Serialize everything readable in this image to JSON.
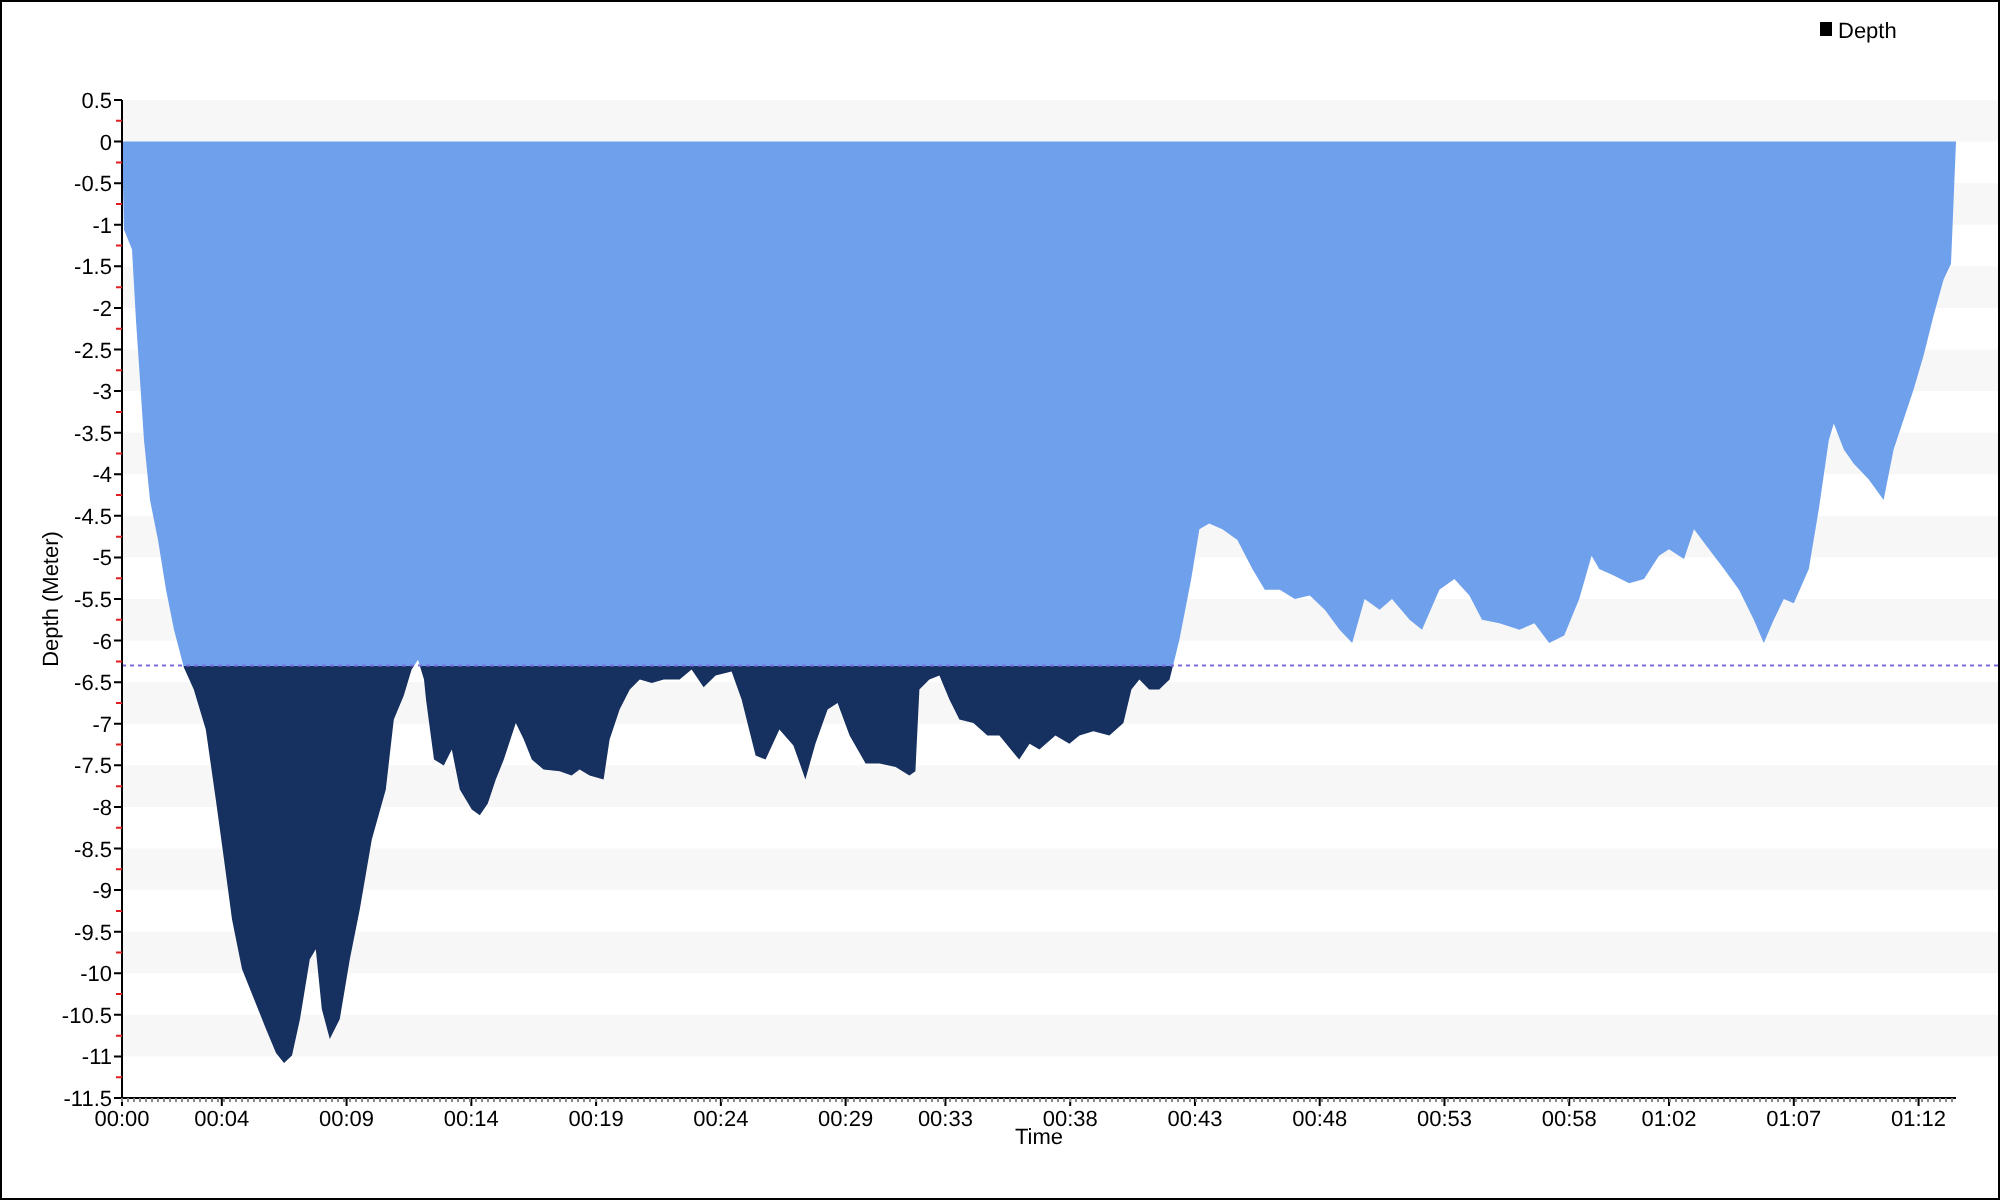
{
  "chart_data": {
    "type": "area",
    "xlabel": "Time",
    "ylabel": "Depth (Meter)",
    "x": [
      0,
      0.08,
      0.4,
      0.56,
      0.72,
      0.88,
      1.12,
      1.44,
      1.76,
      2.08,
      2.48,
      2.88,
      3.36,
      3.76,
      4.09,
      4.41,
      4.81,
      5.29,
      5.77,
      6.17,
      6.49,
      6.81,
      7.13,
      7.53,
      7.77,
      8.01,
      8.33,
      8.73,
      9.13,
      9.53,
      10.01,
      10.57,
      10.89,
      11.29,
      11.61,
      11.86,
      12.1,
      12.18,
      12.5,
      12.9,
      13.22,
      13.54,
      14.02,
      14.34,
      14.66,
      14.98,
      15.3,
      15.78,
      16.1,
      16.42,
      16.9,
      17.54,
      18.02,
      18.34,
      18.74,
      19.3,
      19.54,
      19.94,
      20.35,
      20.75,
      21.23,
      21.71,
      22.35,
      22.83,
      23.31,
      23.79,
      24.43,
      24.83,
      25.39,
      25.79,
      26.35,
      26.91,
      27.39,
      27.79,
      28.28,
      28.68,
      29.16,
      29.8,
      30.36,
      31.0,
      31.56,
      31.8,
      31.96,
      32.36,
      32.76,
      33.16,
      33.56,
      34.12,
      34.68,
      35.16,
      35.96,
      36.37,
      36.77,
      37.41,
      37.97,
      38.37,
      38.93,
      39.57,
      40.13,
      40.45,
      40.77,
      41.17,
      41.57,
      41.98,
      42.38,
      42.85,
      43.18,
      43.57,
      44.1,
      44.7,
      45.3,
      45.8,
      46.4,
      47.0,
      47.6,
      48.2,
      48.8,
      49.3,
      49.8,
      50.4,
      50.9,
      51.6,
      52.1,
      52.8,
      53.4,
      54.0,
      54.5,
      55.2,
      56.0,
      56.6,
      57.2,
      57.8,
      58.4,
      58.9,
      59.2,
      59.8,
      60.4,
      61.0,
      61.6,
      62.0,
      62.6,
      63.0,
      63.6,
      64.2,
      64.8,
      65.4,
      65.8,
      66.2,
      66.6,
      67.0,
      67.6,
      68.0,
      68.4,
      68.6,
      69.0,
      69.4,
      70.0,
      70.6,
      71.0,
      71.4,
      71.8,
      72.2,
      72.6,
      73.0,
      73.3,
      73.5
    ],
    "series": [
      {
        "name": "Depth",
        "color": "#6fa0ec",
        "values": [
          0,
          -1.06,
          -1.3,
          -2.15,
          -2.87,
          -3.59,
          -4.31,
          -4.79,
          -5.39,
          -5.87,
          -6.32,
          -6.59,
          -7.07,
          -7.91,
          -8.63,
          -9.35,
          -9.95,
          -10.31,
          -10.67,
          -10.96,
          -11.08,
          -10.99,
          -10.55,
          -9.83,
          -9.71,
          -10.43,
          -10.79,
          -10.55,
          -9.83,
          -9.23,
          -8.39,
          -7.79,
          -6.95,
          -6.66,
          -6.35,
          -6.23,
          -6.47,
          -6.71,
          -7.43,
          -7.5,
          -7.31,
          -7.79,
          -8.03,
          -8.1,
          -7.96,
          -7.67,
          -7.43,
          -6.99,
          -7.19,
          -7.43,
          -7.55,
          -7.57,
          -7.62,
          -7.55,
          -7.62,
          -7.67,
          -7.19,
          -6.83,
          -6.59,
          -6.47,
          -6.51,
          -6.47,
          -6.47,
          -6.35,
          -6.56,
          -6.42,
          -6.37,
          -6.71,
          -7.38,
          -7.43,
          -7.07,
          -7.26,
          -7.67,
          -7.24,
          -6.83,
          -6.75,
          -7.14,
          -7.48,
          -7.48,
          -7.52,
          -7.62,
          -7.57,
          -6.59,
          -6.47,
          -6.42,
          -6.71,
          -6.95,
          -6.99,
          -7.14,
          -7.14,
          -7.43,
          -7.24,
          -7.31,
          -7.14,
          -7.24,
          -7.14,
          -7.09,
          -7.14,
          -6.99,
          -6.59,
          -6.47,
          -6.59,
          -6.59,
          -6.47,
          -5.99,
          -5.26,
          -4.66,
          -4.59,
          -4.66,
          -4.79,
          -5.14,
          -5.39,
          -5.39,
          -5.5,
          -5.46,
          -5.63,
          -5.87,
          -6.03,
          -5.5,
          -5.63,
          -5.5,
          -5.75,
          -5.87,
          -5.39,
          -5.26,
          -5.46,
          -5.75,
          -5.79,
          -5.87,
          -5.79,
          -6.03,
          -5.94,
          -5.5,
          -4.98,
          -5.14,
          -5.22,
          -5.31,
          -5.26,
          -4.98,
          -4.9,
          -5.02,
          -4.66,
          -4.9,
          -5.14,
          -5.39,
          -5.75,
          -6.03,
          -5.75,
          -5.5,
          -5.55,
          -5.14,
          -4.42,
          -3.59,
          -3.39,
          -3.7,
          -3.87,
          -4.06,
          -4.31,
          -3.7,
          -3.34,
          -2.98,
          -2.57,
          -2.09,
          -1.66,
          -1.47,
          0
        ]
      }
    ],
    "xlim": [
      0,
      73.5
    ],
    "ylim": [
      -11.5,
      0.5
    ],
    "xticks": [
      {
        "value": 0,
        "label": "00:00"
      },
      {
        "value": 4,
        "label": "00:04"
      },
      {
        "value": 9,
        "label": "00:09"
      },
      {
        "value": 14,
        "label": "00:14"
      },
      {
        "value": 19,
        "label": "00:19"
      },
      {
        "value": 24,
        "label": "00:24"
      },
      {
        "value": 29,
        "label": "00:29"
      },
      {
        "value": 33,
        "label": "00:33"
      },
      {
        "value": 38,
        "label": "00:38"
      },
      {
        "value": 43,
        "label": "00:43"
      },
      {
        "value": 48,
        "label": "00:48"
      },
      {
        "value": 53,
        "label": "00:53"
      },
      {
        "value": 58,
        "label": "00:58"
      },
      {
        "value": 62,
        "label": "01:02"
      },
      {
        "value": 67,
        "label": "01:07"
      },
      {
        "value": 72,
        "label": "01:12"
      }
    ],
    "yticks": [
      0.5,
      0,
      -0.5,
      -1,
      -1.5,
      -2,
      -2.5,
      -3,
      -3.5,
      -4,
      -4.5,
      -5,
      -5.5,
      -6,
      -6.5,
      -7,
      -7.5,
      -8,
      -8.5,
      -9,
      -9.5,
      -10,
      -10.5,
      -11,
      -11.5
    ],
    "ref_lines": [
      {
        "axis": "y",
        "value": -6.3,
        "color": "#7b6fe0"
      }
    ]
  }
}
